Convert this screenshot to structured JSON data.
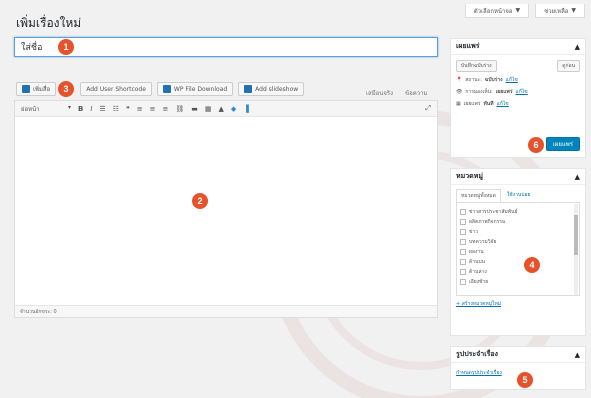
{
  "top_tabs": {
    "screen_options": "ตัวเลือกหน้าจอ",
    "help": "ช่วยเหลือ"
  },
  "page_title": "เพิ่มเรื่องใหม่",
  "title_field": {
    "value": "ใส่ชื่อ"
  },
  "markers": [
    "1",
    "2",
    "3",
    "4",
    "5",
    "6"
  ],
  "media_buttons": {
    "add_media": "เพิ่มสื่อ",
    "add_shortcode": "Add User Shortcode",
    "wp_file_download": "WP File Download",
    "add_slideshow": "Add slideshow"
  },
  "editor_tabs": {
    "visual": "เสมือนจริง",
    "text": "ข้อความ"
  },
  "toolbar": {
    "format_select": "ย่อหน้า"
  },
  "word_count": "จำนวนอักขระ: 0",
  "publish": {
    "title": "เผยแพร่",
    "save_draft": "บันทึกฉบับร่าง",
    "preview": "ดูก่อน",
    "status_label": "สถานะ:",
    "status_value": "ฉบับร่าง",
    "visibility_label": "การมองเห็น:",
    "visibility_value": "เผยแพร่",
    "schedule_label": "เผยแพร่",
    "schedule_value": "ทันที",
    "edit_link": "แก้ไข",
    "publish_button": "เผยแพร่"
  },
  "categories": {
    "title": "หมวดหมู่",
    "tab_all": "หมวดหมู่ทั้งหมด",
    "tab_popular": "ใช้งานบ่อย",
    "items": [
      "ข่าวสารประชาสัมพันธ์",
      "ผลิตภาพกิจกรรม",
      "ข่าว",
      "บทความวิจัย",
      "ผลงาน",
      "ด้านบน",
      "ด้านล่าง",
      "เอียงซ้าย"
    ],
    "add_new": "+ สร้างหมวดหมู่ใหม่"
  },
  "featured_image": {
    "title": "รูปประจำเรื่อง",
    "set_link": "กำหนดรูปประจำเรื่อง"
  },
  "colors": {
    "marker": "#e6522c",
    "primary": "#0085ba",
    "link": "#0073aa"
  }
}
